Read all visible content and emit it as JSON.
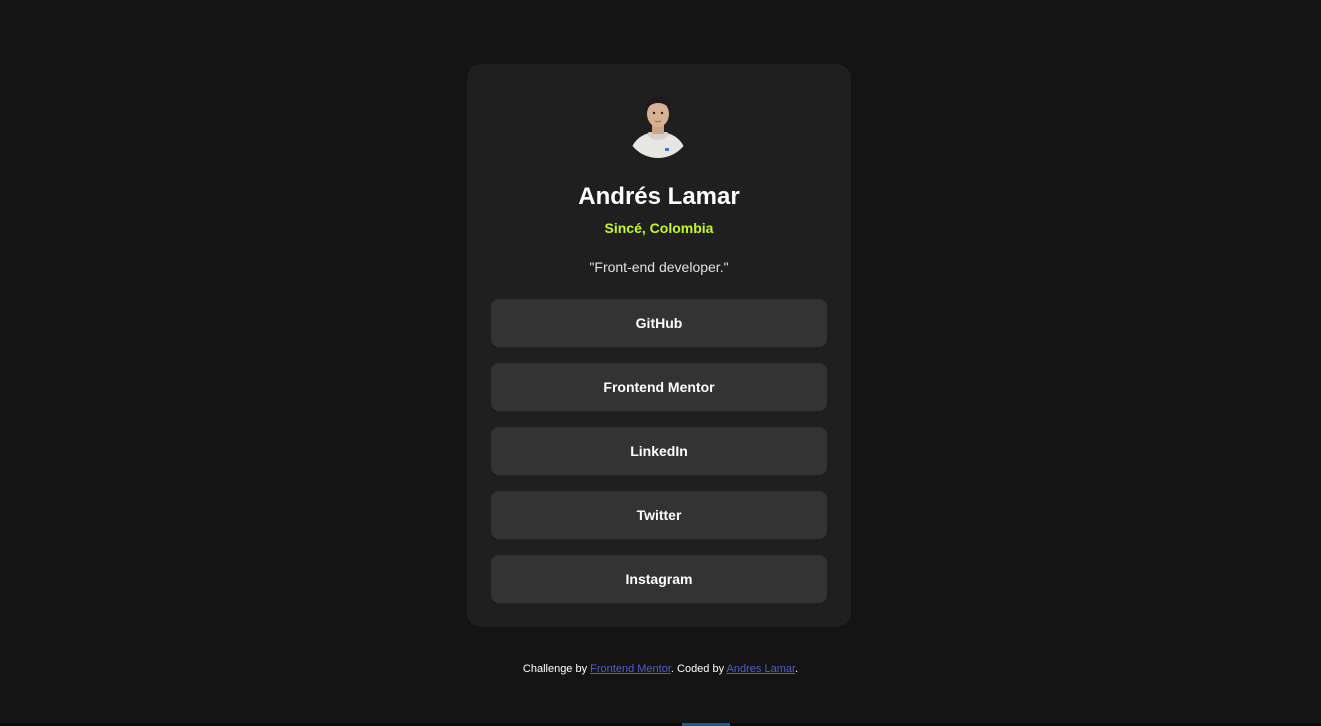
{
  "profile": {
    "name": "Andrés Lamar",
    "location": "Sincé, Colombia",
    "bio": "\"Front-end developer.\""
  },
  "links": [
    {
      "label": "GitHub"
    },
    {
      "label": "Frontend Mentor"
    },
    {
      "label": "LinkedIn"
    },
    {
      "label": "Twitter"
    },
    {
      "label": "Instagram"
    }
  ],
  "footer": {
    "prefix": "Challenge by ",
    "challenge_link": "Frontend Mentor",
    "middle": ". Coded by ",
    "author_link": "Andres Lamar",
    "suffix": "."
  },
  "colors": {
    "background": "#141414",
    "card": "#1f1f1f",
    "button": "#333333",
    "accent_green": "#c4f82a",
    "link_blue": "#4d5fc7"
  }
}
